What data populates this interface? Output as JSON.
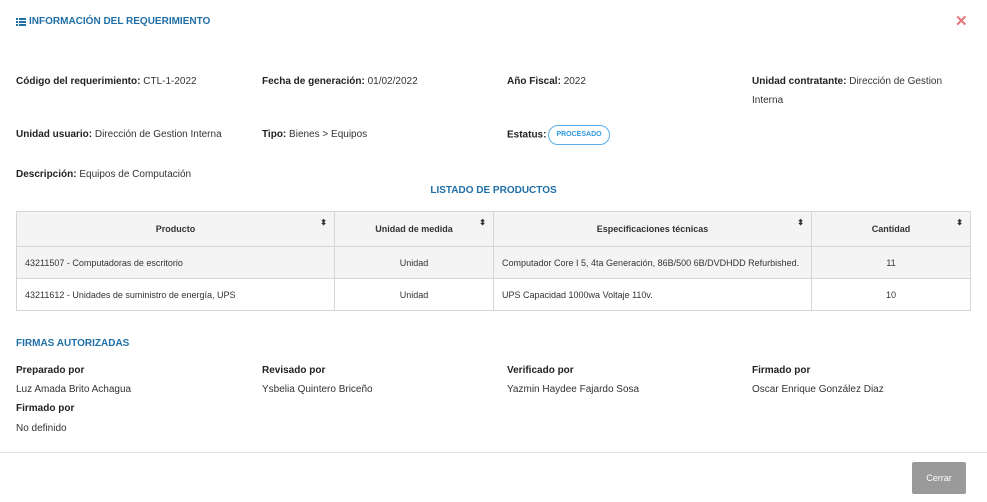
{
  "header": {
    "title": "INFORMACIÓN DEL REQUERIMIENTO",
    "close_symbol": "✕"
  },
  "fields": {
    "codigo": {
      "label": "Código del requerimiento:",
      "value": "CTL-1-2022"
    },
    "fecha": {
      "label": "Fecha de generación:",
      "value": "01/02/2022"
    },
    "anio": {
      "label": "Año Fiscal:",
      "value": "2022"
    },
    "unidad_contratante": {
      "label": "Unidad contratante:",
      "value": "Dirección de Gestion Interna"
    },
    "unidad_usuario": {
      "label": "Unidad usuario:",
      "value": "Dirección de Gestion Interna"
    },
    "tipo": {
      "label": "Tipo:",
      "value": "Bienes > Equipos"
    },
    "estatus": {
      "label": "Estatus:",
      "value": "PROCESADO"
    },
    "descripcion": {
      "label": "Descripción:",
      "value": "Equipos de Computación"
    }
  },
  "products": {
    "title": "LISTADO DE PRODUCTOS",
    "columns": [
      "Producto",
      "Unidad de medida",
      "Especificaciones técnicas",
      "Cantidad"
    ],
    "rows": [
      {
        "producto": "43211507 - Computadoras de escritorio",
        "unidad": "Unidad",
        "especificaciones": "Computador Core I 5, 4ta Generación, 86B/500 6B/DVDHDD Refurbished.",
        "cantidad": "11"
      },
      {
        "producto": "43211612 - Unidades de suministro de energía, UPS",
        "unidad": "Unidad",
        "especificaciones": "UPS Capacidad 1000wa Voltaje 110v.",
        "cantidad": "10"
      }
    ]
  },
  "signatures": {
    "title": "FIRMAS AUTORIZADAS",
    "items": [
      {
        "label": "Preparado por",
        "name": "Luz Amada Brito Achagua"
      },
      {
        "label": "Revisado por",
        "name": "Ysbelia Quintero Briceño"
      },
      {
        "label": "Verificado por",
        "name": "Yazmin Haydee Fajardo Sosa"
      },
      {
        "label": "Firmado por",
        "name": "Oscar Enrique González Diaz"
      },
      {
        "label": "Firmado por",
        "name": "No definido"
      }
    ]
  },
  "footer": {
    "close_label": "Cerrar"
  },
  "icons": {
    "header": "list-icon",
    "close": "close-icon",
    "sort": "sort-icon"
  },
  "colors": {
    "accent": "#1f6fa8",
    "close": "#e8777b",
    "badge": "#2f9ae0",
    "button": "#9a9a9a"
  }
}
